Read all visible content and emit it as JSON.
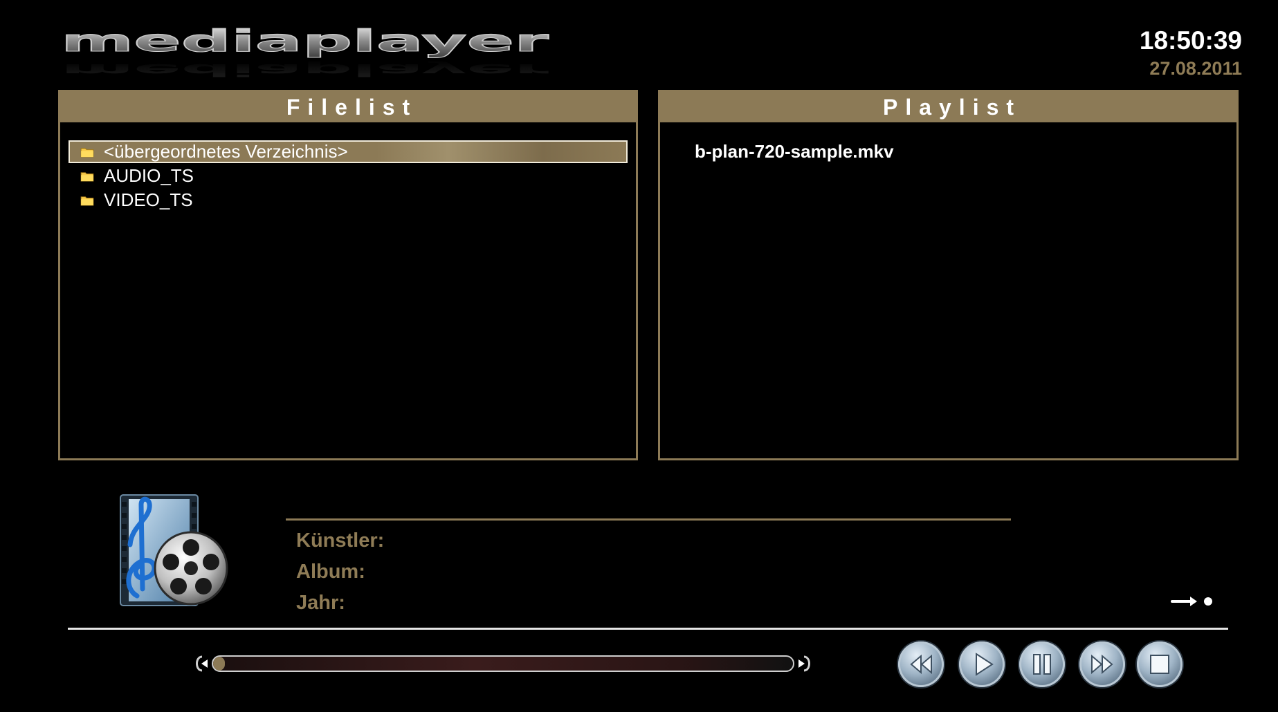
{
  "logo": {
    "text": "mediaplayer"
  },
  "clock": {
    "time": "18:50:39",
    "date": "27.08.2011"
  },
  "filelist": {
    "title": "Filelist",
    "items": [
      {
        "label": "<übergeordnetes Verzeichnis>",
        "icon": "folder-icon",
        "selected": true
      },
      {
        "label": "AUDIO_TS",
        "icon": "folder-icon",
        "selected": false
      },
      {
        "label": "VIDEO_TS",
        "icon": "folder-icon",
        "selected": false
      }
    ]
  },
  "playlist": {
    "title": "Playlist",
    "items": [
      {
        "label": "b-plan-720-sample.mkv"
      }
    ]
  },
  "info": {
    "artist_label": "Künstler:",
    "album_label": "Album:",
    "year_label": "Jahr:"
  },
  "progress": {
    "fraction": 0.02
  },
  "controls": {
    "rewind": "rewind-icon",
    "play": "play-icon",
    "pause": "pause-icon",
    "forward": "fast-forward-icon",
    "stop": "stop-icon"
  },
  "colors": {
    "accent": "#8c7a56",
    "date": "#8f7c56",
    "background": "#000000",
    "text": "#ffffff"
  }
}
